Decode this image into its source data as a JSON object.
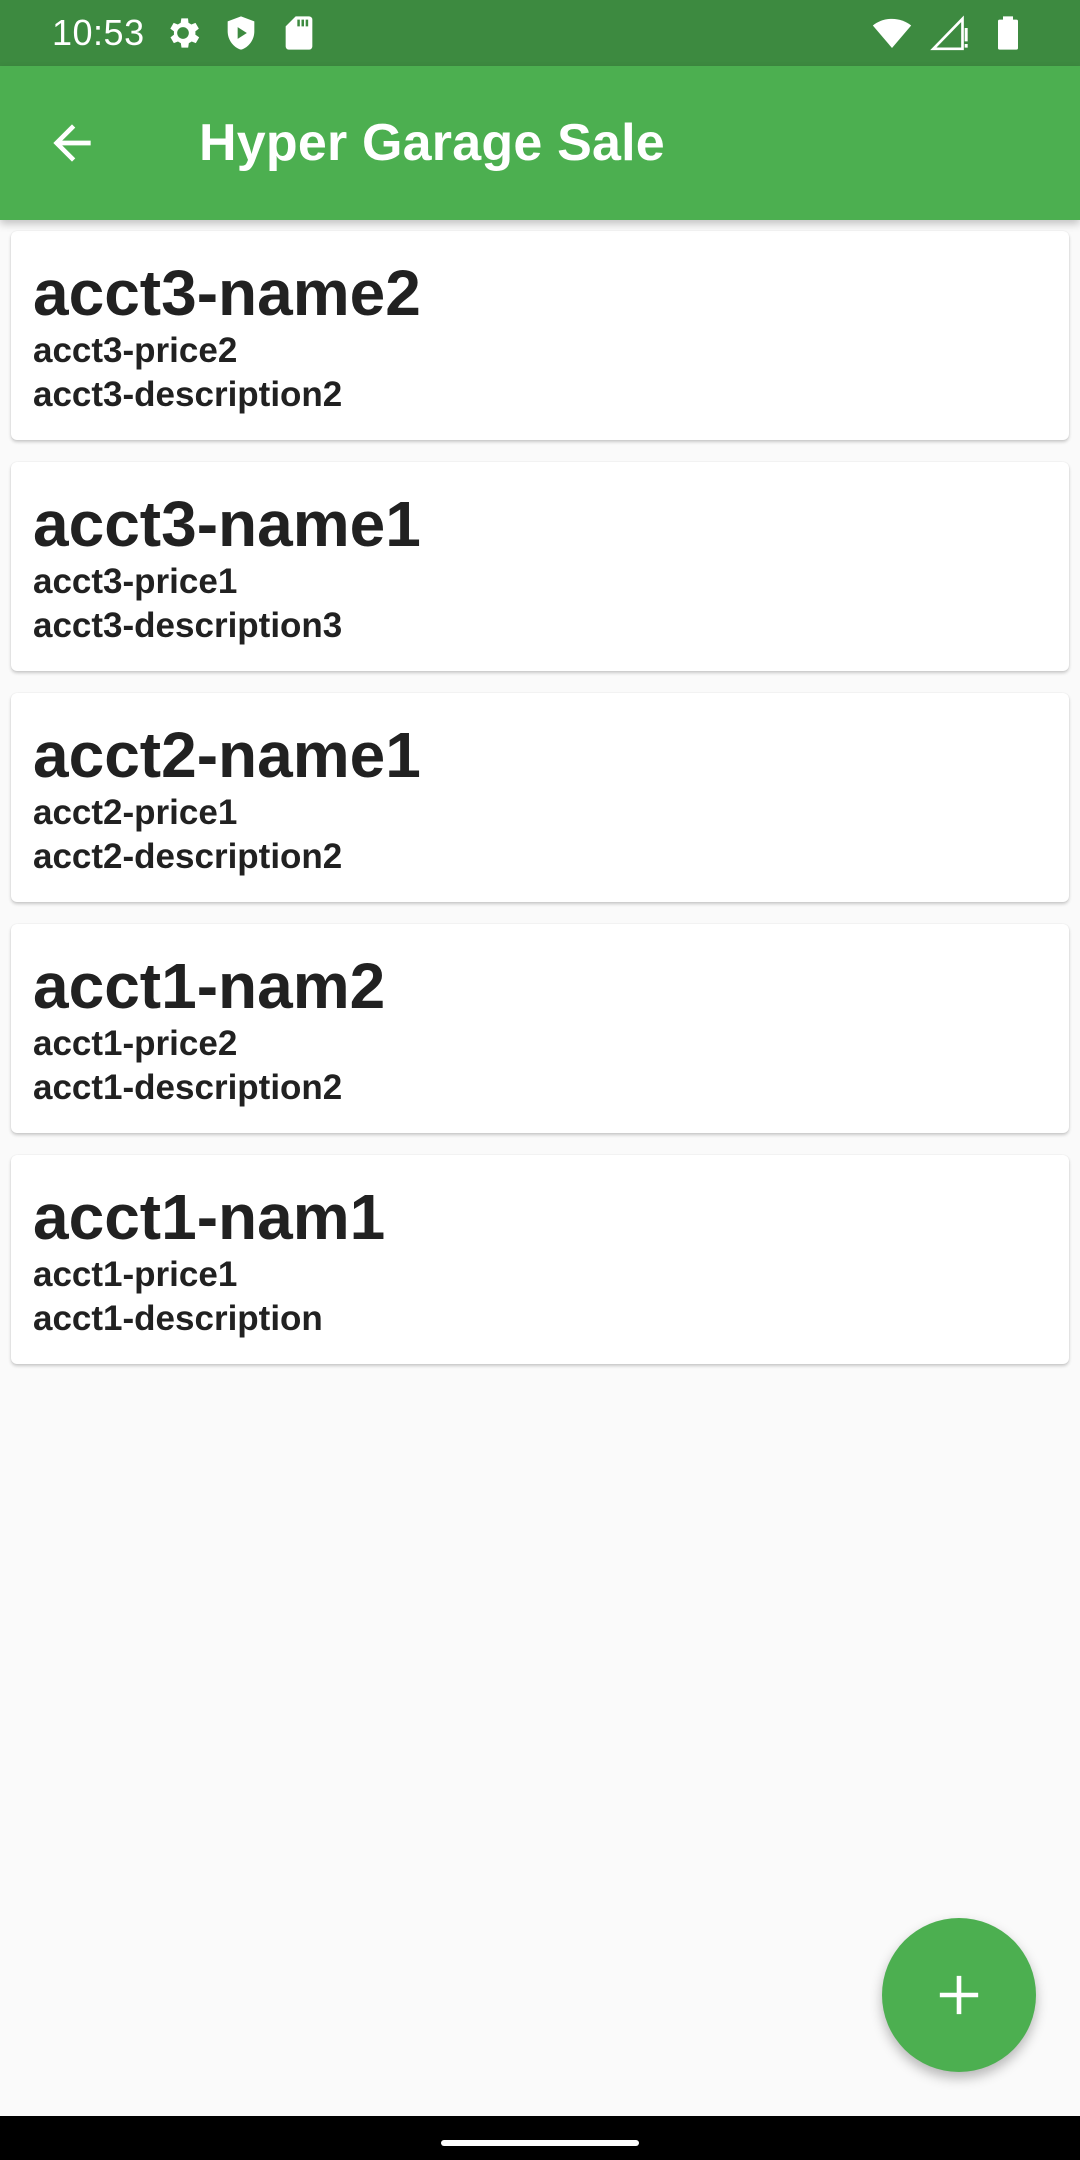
{
  "status_bar": {
    "time": "10:53",
    "icons_left": [
      "gear-icon",
      "shield-play-icon",
      "sd-card-icon"
    ],
    "icons_right": [
      "wifi-icon",
      "signal-icon",
      "battery-icon"
    ]
  },
  "app_bar": {
    "title": "Hyper Garage Sale",
    "back_icon": "arrow-left-icon",
    "color": "#4caf50"
  },
  "items": [
    {
      "name": "acct3-name2",
      "price": "acct3-price2",
      "description": "acct3-description2"
    },
    {
      "name": "acct3-name1",
      "price": "acct3-price1",
      "description": "acct3-description3"
    },
    {
      "name": "acct2-name1",
      "price": "acct2-price1",
      "description": "acct2-description2"
    },
    {
      "name": "acct1-nam2",
      "price": "acct1-price2",
      "description": "acct1-description2"
    },
    {
      "name": "acct1-nam1",
      "price": "acct1-price1",
      "description": "acct1-description"
    }
  ],
  "fab": {
    "icon": "plus-icon",
    "color": "#4caf50"
  },
  "colors": {
    "status_bar": "#3d8a40",
    "background": "#fafafa",
    "text": "#212121"
  }
}
